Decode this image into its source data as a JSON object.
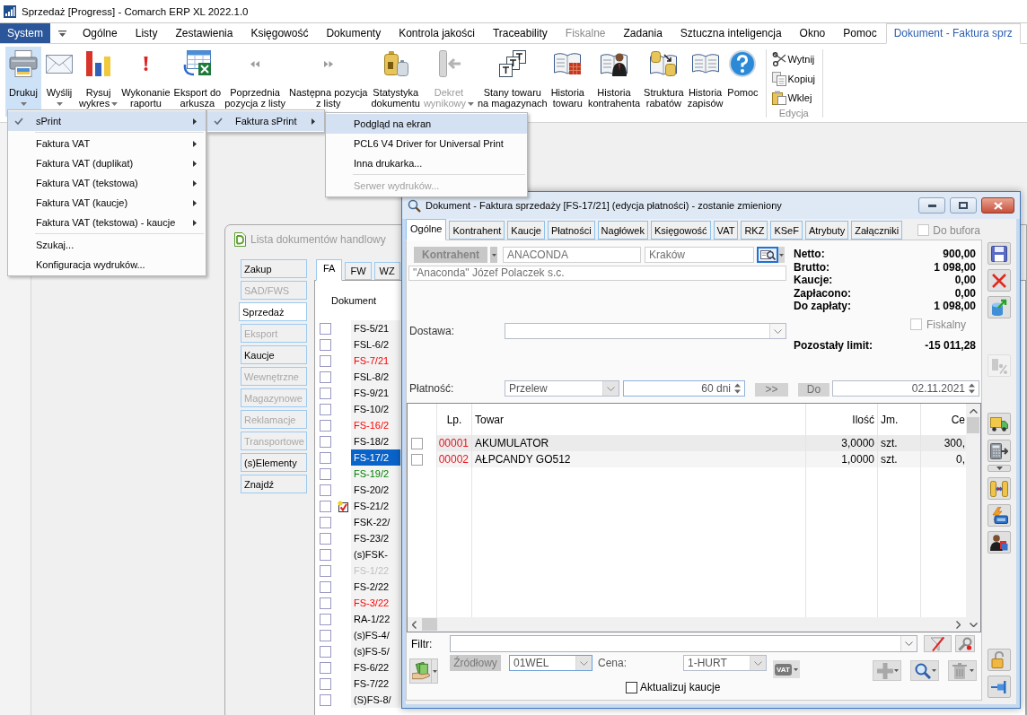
{
  "window": {
    "title": "Sprzedaż [Progress] - Comarch ERP XL 2022.1.0"
  },
  "ribbon_tabs": [
    {
      "label": "System",
      "kind": "file",
      "selected": false,
      "disabled": false
    },
    {
      "label": "Ogólne",
      "kind": "tab",
      "selected": false,
      "disabled": false
    },
    {
      "label": "Listy",
      "kind": "tab",
      "selected": false,
      "disabled": false
    },
    {
      "label": "Zestawienia",
      "kind": "tab",
      "selected": false,
      "disabled": false
    },
    {
      "label": "Księgowość",
      "kind": "tab",
      "selected": false,
      "disabled": false
    },
    {
      "label": "Dokumenty",
      "kind": "tab",
      "selected": false,
      "disabled": false
    },
    {
      "label": "Kontrola jakości",
      "kind": "tab",
      "selected": false,
      "disabled": false
    },
    {
      "label": "Traceability",
      "kind": "tab",
      "selected": false,
      "disabled": false
    },
    {
      "label": "Fiskalne",
      "kind": "tab",
      "selected": false,
      "disabled": true
    },
    {
      "label": "Zadania",
      "kind": "tab",
      "selected": false,
      "disabled": false
    },
    {
      "label": "Sztuczna inteligencja",
      "kind": "tab",
      "selected": false,
      "disabled": false
    },
    {
      "label": "Okno",
      "kind": "tab",
      "selected": false,
      "disabled": false
    },
    {
      "label": "Pomoc",
      "kind": "tab",
      "selected": false,
      "disabled": false
    },
    {
      "label": "Dokument - Faktura sprz",
      "kind": "context",
      "selected": true,
      "disabled": false
    }
  ],
  "ribbon": {
    "buttons": [
      {
        "label": "Drukuj",
        "kind": "split",
        "selected": true,
        "disabled": false
      },
      {
        "label": "Wyślij",
        "kind": "split",
        "selected": false,
        "disabled": false
      },
      {
        "label": "Rysuj\nwykres",
        "kind": "menu",
        "selected": false,
        "disabled": false
      },
      {
        "label": "Wykonanie\nraportu",
        "kind": "plain",
        "selected": false,
        "disabled": false
      },
      {
        "label": "Eksport do\narkusza",
        "kind": "plain",
        "selected": false,
        "disabled": false
      },
      {
        "label": "Poprzednia\npozycja z listy",
        "kind": "plain",
        "selected": false,
        "disabled": false
      },
      {
        "label": "Następna pozycja\nz listy",
        "kind": "plain",
        "selected": false,
        "disabled": false
      },
      {
        "label": "Statystyka\ndokumentu",
        "kind": "plain",
        "selected": false,
        "disabled": false
      },
      {
        "label": "Dekret\nwynikowy",
        "kind": "menu",
        "selected": false,
        "disabled": true
      },
      {
        "label": "Stany towaru\nna magazynach",
        "kind": "plain",
        "selected": false,
        "disabled": false
      },
      {
        "label": "Historia\ntowaru",
        "kind": "plain",
        "selected": false,
        "disabled": false
      },
      {
        "label": "Historia\nkontrahenta",
        "kind": "plain",
        "selected": false,
        "disabled": false
      },
      {
        "label": "Struktura\nrabatów",
        "kind": "plain",
        "selected": false,
        "disabled": false
      },
      {
        "label": "Historia\nzapisów",
        "kind": "plain",
        "selected": false,
        "disabled": false
      },
      {
        "label": "Pomoc",
        "kind": "plain",
        "selected": false,
        "disabled": false
      }
    ],
    "edit_group": {
      "label": "Edycja",
      "buttons": [
        {
          "label": "Wytnij"
        },
        {
          "label": "Kopiuj"
        },
        {
          "label": "Wklej"
        }
      ]
    }
  },
  "print_menu": {
    "items": [
      {
        "kind": "item",
        "label": "sPrint",
        "checked": true,
        "selected": true,
        "submenu": true,
        "disabled": false
      },
      {
        "kind": "separator"
      },
      {
        "kind": "item",
        "label": "Faktura VAT",
        "checked": false,
        "selected": false,
        "submenu": true,
        "disabled": false
      },
      {
        "kind": "item",
        "label": "Faktura VAT (duplikat)",
        "checked": false,
        "selected": false,
        "submenu": true,
        "disabled": false
      },
      {
        "kind": "item",
        "label": "Faktura VAT (tekstowa)",
        "checked": false,
        "selected": false,
        "submenu": true,
        "disabled": false
      },
      {
        "kind": "item",
        "label": "Faktura VAT (kaucje)",
        "checked": false,
        "selected": false,
        "submenu": true,
        "disabled": false
      },
      {
        "kind": "item",
        "label": "Faktura VAT (tekstowa) - kaucje",
        "checked": false,
        "selected": false,
        "submenu": true,
        "disabled": false
      },
      {
        "kind": "separator"
      },
      {
        "kind": "item",
        "label": "Szukaj...",
        "checked": false,
        "selected": false,
        "submenu": false,
        "disabled": false
      },
      {
        "kind": "item",
        "label": "Konfiguracja wydruków...",
        "checked": false,
        "selected": false,
        "submenu": false,
        "disabled": false
      }
    ]
  },
  "print_submenu": {
    "items": [
      {
        "kind": "item",
        "label": "Faktura sPrint",
        "checked": true,
        "selected": true,
        "submenu": true,
        "disabled": false
      }
    ]
  },
  "printer_menu": {
    "items": [
      {
        "kind": "item",
        "label": "Podgląd na ekran",
        "checked": false,
        "selected": true,
        "submenu": false,
        "disabled": false
      },
      {
        "kind": "item",
        "label": "PCL6 V4 Driver for Universal Print",
        "checked": false,
        "selected": false,
        "submenu": false,
        "disabled": false
      },
      {
        "kind": "item",
        "label": "Inna drukarka...",
        "checked": false,
        "selected": false,
        "submenu": false,
        "disabled": false
      },
      {
        "kind": "separator"
      },
      {
        "kind": "item",
        "label": "Serwer wydruków...",
        "checked": false,
        "selected": false,
        "submenu": false,
        "disabled": true
      }
    ]
  },
  "document_list": {
    "title": "Lista dokumentów handlowy",
    "side_tabs": [
      {
        "label": "Zakup",
        "selected": false,
        "disabled": false
      },
      {
        "label": "SAD/FWS",
        "selected": false,
        "disabled": true
      },
      {
        "label": "Sprzedaż",
        "selected": true,
        "disabled": false
      },
      {
        "label": "Eksport",
        "selected": false,
        "disabled": true
      },
      {
        "label": "Kaucje",
        "selected": false,
        "disabled": false
      },
      {
        "label": "Wewnętrzne",
        "selected": false,
        "disabled": true
      },
      {
        "label": "Magazynowe",
        "selected": false,
        "disabled": true
      },
      {
        "label": "Reklamacje",
        "selected": false,
        "disabled": true
      },
      {
        "label": "Transportowe",
        "selected": false,
        "disabled": true
      },
      {
        "label": "(s)Elementy",
        "selected": false,
        "disabled": false
      },
      {
        "label": "Znajdź",
        "selected": false,
        "disabled": false
      }
    ],
    "type_tabs": [
      {
        "label": "FA",
        "selected": true
      },
      {
        "label": "FW",
        "selected": false
      },
      {
        "label": "WZ",
        "selected": false
      }
    ],
    "column_header": "Dokument",
    "rows": [
      {
        "number": "FS-5/21",
        "color": "#000000",
        "checked": false,
        "selected": false,
        "note": false
      },
      {
        "number": "FSL-6/2",
        "color": "#000000",
        "checked": false,
        "selected": false,
        "note": false
      },
      {
        "number": "FS-7/21",
        "color": "#ff0000",
        "checked": false,
        "selected": false,
        "note": false
      },
      {
        "number": "FSL-8/2",
        "color": "#000000",
        "checked": false,
        "selected": false,
        "note": false
      },
      {
        "number": "FS-9/21",
        "color": "#000000",
        "checked": false,
        "selected": false,
        "note": false
      },
      {
        "number": "FS-10/2",
        "color": "#000000",
        "checked": false,
        "selected": false,
        "note": false
      },
      {
        "number": "FS-16/2",
        "color": "#ff0000",
        "checked": false,
        "selected": false,
        "note": false
      },
      {
        "number": "FS-18/2",
        "color": "#000000",
        "checked": false,
        "selected": false,
        "note": false
      },
      {
        "number": "FS-17/2",
        "color": "#ffffff",
        "checked": false,
        "selected": true,
        "note": false
      },
      {
        "number": "FS-19/2",
        "color": "#008000",
        "checked": false,
        "selected": false,
        "note": false
      },
      {
        "number": "FS-20/2",
        "color": "#000000",
        "checked": false,
        "selected": false,
        "note": false
      },
      {
        "number": "FS-21/2",
        "color": "#000000",
        "checked": false,
        "selected": false,
        "note": true
      },
      {
        "number": "FSK-22/",
        "color": "#000000",
        "checked": false,
        "selected": false,
        "note": false
      },
      {
        "number": "FS-23/2",
        "color": "#000000",
        "checked": false,
        "selected": false,
        "note": false
      },
      {
        "number": "(s)FSK-",
        "color": "#000000",
        "checked": false,
        "selected": false,
        "note": false
      },
      {
        "number": "FS-1/22",
        "color": "#c0c0c0",
        "checked": false,
        "selected": false,
        "note": false
      },
      {
        "number": "FS-2/22",
        "color": "#000000",
        "checked": false,
        "selected": false,
        "note": false
      },
      {
        "number": "FS-3/22",
        "color": "#ff0000",
        "checked": false,
        "selected": false,
        "note": false
      },
      {
        "number": "RA-1/22",
        "color": "#000000",
        "checked": false,
        "selected": false,
        "note": false
      },
      {
        "number": "(s)FS-4/",
        "color": "#000000",
        "checked": false,
        "selected": false,
        "note": false
      },
      {
        "number": "(s)FS-5/",
        "color": "#000000",
        "checked": false,
        "selected": false,
        "note": false
      },
      {
        "number": "FS-6/22",
        "color": "#000000",
        "checked": false,
        "selected": false,
        "note": false
      },
      {
        "number": "FS-7/22",
        "color": "#000000",
        "checked": false,
        "selected": false,
        "note": false
      },
      {
        "number": "(S)FS-8/",
        "color": "#000000",
        "checked": false,
        "selected": false,
        "note": false
      }
    ]
  },
  "dialog": {
    "title": "Dokument - Faktura sprzedaży [FS-17/21] (edycja płatności) - zostanie zmieniony",
    "tabs": [
      {
        "label": "Ogólne",
        "selected": true
      },
      {
        "label": "Kontrahent",
        "selected": false
      },
      {
        "label": "Kaucje",
        "selected": false
      },
      {
        "label": "Płatności",
        "selected": false
      },
      {
        "label": "Nagłówek",
        "selected": false
      },
      {
        "label": "Księgowość",
        "selected": false
      },
      {
        "label": "VAT",
        "selected": false
      },
      {
        "label": "RKZ",
        "selected": false
      },
      {
        "label": "KSeF",
        "selected": false
      },
      {
        "label": "Atrybuty",
        "selected": false
      },
      {
        "label": "Załączniki",
        "selected": false
      }
    ],
    "to_buffer": {
      "label": "Do bufora",
      "checked": false,
      "disabled": true
    },
    "contractor": {
      "button": "Kontrahent",
      "code": "ANACONDA",
      "city": "Kraków",
      "name": "\"Anaconda\" Józef Polaczek s.c."
    },
    "totals": [
      {
        "label": "Netto:",
        "value": "900,00"
      },
      {
        "label": "Brutto:",
        "value": "1 098,00"
      },
      {
        "label": "Kaucje:",
        "value": "0,00"
      },
      {
        "label": "Zapłacono:",
        "value": "0,00"
      },
      {
        "label": "Do zapłaty:",
        "value": "1 098,00"
      }
    ],
    "fiscal": {
      "label": "Fiskalny",
      "checked": false,
      "disabled": true
    },
    "limit": {
      "label": "Pozostały limit:",
      "value": "-15 011,28"
    },
    "delivery": {
      "label": "Dostawa:"
    },
    "payment": {
      "label": "Płatność:",
      "method": "Przelew",
      "term": "60 dni",
      "shift_button": ">>",
      "to_button": "Do",
      "date": "02.11.2021"
    },
    "items_table": {
      "columns": [
        "Lp.",
        "Towar",
        "Ilość",
        "Jm.",
        "Ce"
      ],
      "rows": [
        {
          "checked": false,
          "lp": "00001",
          "name": "AKUMULATOR",
          "qty": "3,0000",
          "unit": "szt.",
          "price": "300,"
        },
        {
          "checked": false,
          "lp": "00002",
          "name": "AŁPCANDY GO512",
          "qty": "1,0000",
          "unit": "szt.",
          "price": "0,"
        }
      ]
    },
    "filter": {
      "label": "Filtr:"
    },
    "bottom": {
      "source_button": "Źródłowy",
      "warehouse": "01WEL",
      "price_label": "Cena:",
      "price_list": "1-HURT",
      "vat_button": "VAT",
      "update_deposits": {
        "label": "Aktualizuj kaucje",
        "checked": false
      }
    },
    "side_toolbar": [
      {
        "buttons": [
          {
            "kind": "button",
            "disabled": false
          },
          {
            "kind": "button",
            "disabled": false
          },
          {
            "kind": "button",
            "disabled": false
          }
        ]
      },
      {
        "buttons": [
          {
            "kind": "button",
            "disabled": true
          }
        ]
      },
      {
        "buttons": [
          {
            "kind": "button",
            "disabled": false
          },
          {
            "kind": "button",
            "disabled": false
          },
          {
            "kind": "dropdown",
            "disabled": false
          },
          {
            "kind": "button",
            "disabled": false
          },
          {
            "kind": "button",
            "disabled": false
          },
          {
            "kind": "button",
            "disabled": false
          }
        ]
      },
      {
        "buttons": [
          {
            "kind": "button",
            "disabled": false
          },
          {
            "kind": "button",
            "disabled": false
          }
        ]
      }
    ]
  }
}
